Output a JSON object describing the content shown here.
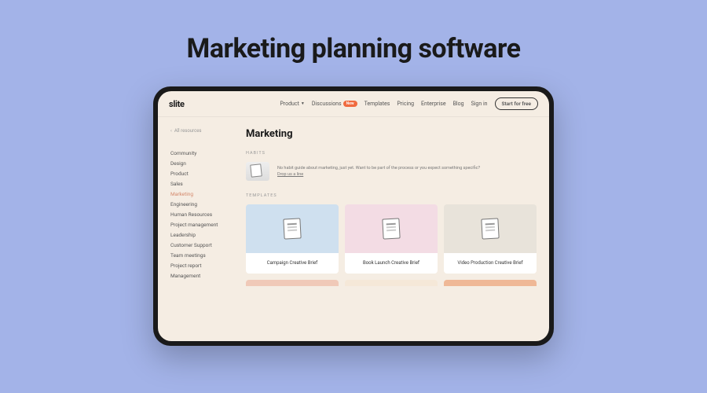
{
  "headline": "Marketing planning software",
  "logo": "slite",
  "nav": {
    "product": "Product",
    "discussions": "Discussions",
    "new_badge": "New",
    "templates": "Templates",
    "pricing": "Pricing",
    "enterprise": "Enterprise",
    "blog": "Blog",
    "signin": "Sign in",
    "cta": "Start for free"
  },
  "sidebar": {
    "all_resources": "All resources",
    "items": [
      "Community",
      "Design",
      "Product",
      "Sales",
      "Marketing",
      "Engineering",
      "Human Resources",
      "Project management",
      "Leadership",
      "Customer Support",
      "Team meetings",
      "Project report",
      "Management"
    ],
    "active_index": 4
  },
  "main": {
    "title": "Marketing",
    "habits_label": "HABITS",
    "habits_text": "No habit guide about marketing, just yet. Want to be part of the process or you expect something specific?",
    "habits_link": "Drop us a line",
    "templates_label": "TEMPLATES",
    "templates": [
      {
        "title": "Campaign Creative Brief",
        "color": "blue"
      },
      {
        "title": "Book Launch Creative Brief",
        "color": "pink"
      },
      {
        "title": "Video Production Creative Brief",
        "color": "gray"
      }
    ]
  }
}
